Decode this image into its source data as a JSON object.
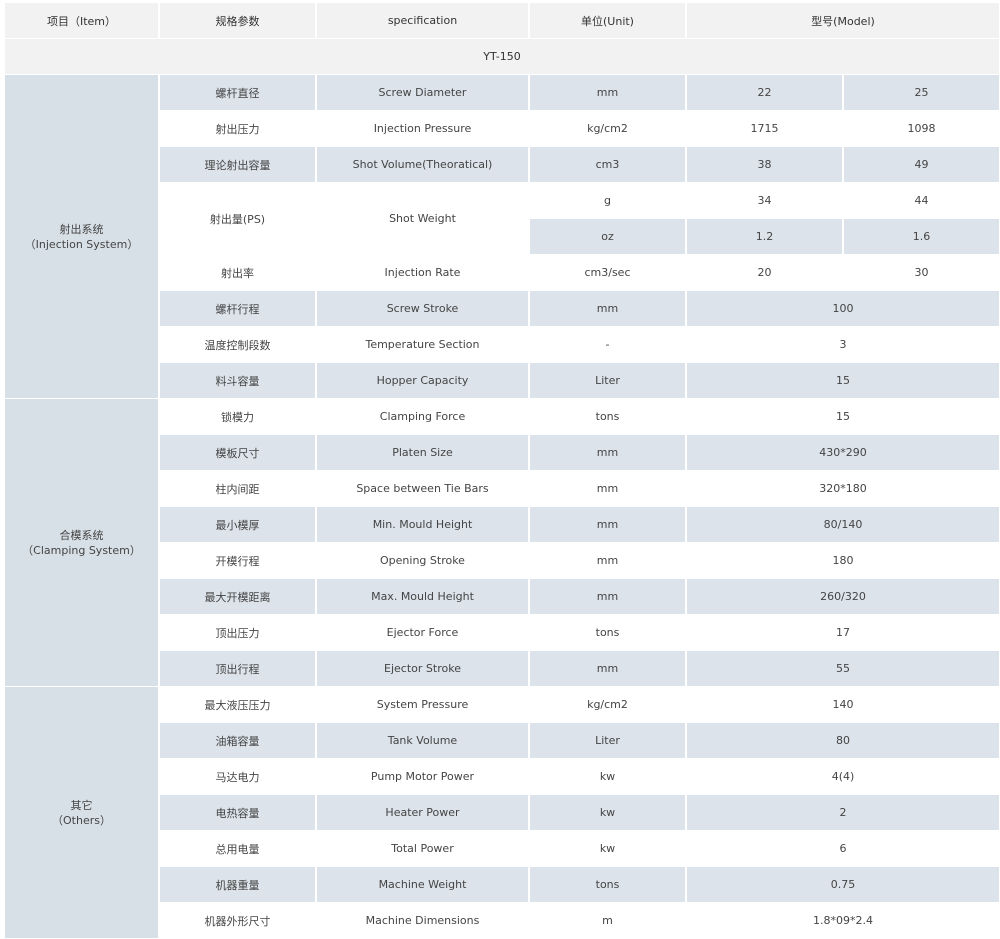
{
  "header": {
    "item": "项目（Item）",
    "spec_cn": "规格参数",
    "spec_en": "specification",
    "unit": "单位(Unit)",
    "model": "型号(Model)"
  },
  "model_name": "YT-150",
  "groups": [
    {
      "name_cn": "射出系统",
      "name_en": "（Injection System）",
      "rows": [
        {
          "cn": "螺杆直径",
          "en": "Screw Diameter",
          "unit": "mm",
          "values": [
            "22",
            "25"
          ]
        },
        {
          "cn": "射出压力",
          "en": "Injection Pressure",
          "unit": "kg/cm2",
          "values": [
            "1715",
            "1098"
          ]
        },
        {
          "cn": "理论射出容量",
          "en": "Shot Volume(Theoratical)",
          "unit": "cm3",
          "values": [
            "38",
            "49"
          ]
        },
        {
          "cn": "射出量(PS)",
          "en": "Shot Weight",
          "units": [
            {
              "unit": "g",
              "values": [
                "34",
                "44"
              ]
            },
            {
              "unit": "oz",
              "values": [
                "1.2",
                "1.6"
              ]
            }
          ]
        },
        {
          "cn": "射出率",
          "en": "Injection Rate",
          "unit": "cm3/sec",
          "values": [
            "20",
            "30"
          ]
        },
        {
          "cn": "螺杆行程",
          "en": "Screw Stroke",
          "unit": "mm",
          "values": [
            "100"
          ]
        },
        {
          "cn": "温度控制段数",
          "en": "Temperature Section",
          "unit": "-",
          "values": [
            "3"
          ]
        },
        {
          "cn": "料斗容量",
          "en": "Hopper Capacity",
          "unit": "Liter",
          "values": [
            "15"
          ]
        }
      ]
    },
    {
      "name_cn": "合模系统",
      "name_en": "（Clamping System）",
      "rows": [
        {
          "cn": "锁模力",
          "en": "Clamping Force",
          "unit": "tons",
          "values": [
            "15"
          ]
        },
        {
          "cn": "模板尺寸",
          "en": "Platen Size",
          "unit": "mm",
          "values": [
            "430*290"
          ]
        },
        {
          "cn": "柱内间距",
          "en": "Space between Tie Bars",
          "unit": "mm",
          "values": [
            "320*180"
          ]
        },
        {
          "cn": "最小模厚",
          "en": "Min. Mould Height",
          "unit": "mm",
          "values": [
            "80/140"
          ]
        },
        {
          "cn": "开模行程",
          "en": "Opening Stroke",
          "unit": "mm",
          "values": [
            "180"
          ]
        },
        {
          "cn": "最大开模距离",
          "en": "Max. Mould Height",
          "unit": "mm",
          "values": [
            "260/320"
          ]
        },
        {
          "cn": "顶出压力",
          "en": "Ejector Force",
          "unit": "tons",
          "values": [
            "17"
          ]
        },
        {
          "cn": "顶出行程",
          "en": "Ejector Stroke",
          "unit": "mm",
          "values": [
            "55"
          ]
        }
      ]
    },
    {
      "name_cn": "其它",
      "name_en": "（Others）",
      "rows": [
        {
          "cn": "最大液压压力",
          "en": "System Pressure",
          "unit": "kg/cm2",
          "values": [
            "140"
          ]
        },
        {
          "cn": "油箱容量",
          "en": "Tank Volume",
          "unit": "Liter",
          "values": [
            "80"
          ]
        },
        {
          "cn": "马达电力",
          "en": "Pump Motor Power",
          "unit": "kw",
          "values": [
            "4(4)"
          ]
        },
        {
          "cn": "电热容量",
          "en": "Heater Power",
          "unit": "kw",
          "values": [
            "2"
          ]
        },
        {
          "cn": "总用电量",
          "en": "Total Power",
          "unit": "kw",
          "values": [
            "6"
          ]
        },
        {
          "cn": "机器重量",
          "en": "Machine Weight",
          "unit": "tons",
          "values": [
            "0.75"
          ]
        },
        {
          "cn": "机器外形尺寸",
          "en": "Machine Dimensions",
          "unit": "m",
          "values": [
            "1.8*09*2.4"
          ]
        }
      ]
    }
  ]
}
